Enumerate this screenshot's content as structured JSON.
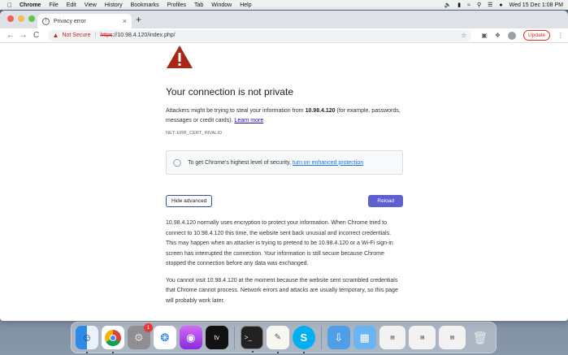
{
  "menubar": {
    "apple": "",
    "app": "Chrome",
    "items": [
      "File",
      "Edit",
      "View",
      "History",
      "Bookmarks",
      "Profiles",
      "Tab",
      "Window",
      "Help"
    ],
    "clock": "Wed 15 Dec  1:08 PM"
  },
  "tab": {
    "title": "Privacy error",
    "close": "×",
    "new_tab": "+"
  },
  "toolbar": {
    "back": "←",
    "forward": "→",
    "reload": "C",
    "not_secure": "Not Secure",
    "separator": "|",
    "url_scheme": "https",
    "url_rest": "://10.98.4.120/index.php/",
    "update_label": "Update"
  },
  "page": {
    "heading": "Your connection is not private",
    "intro_before": "Attackers might be trying to steal your information from ",
    "host": "10.98.4.120",
    "intro_after": " (for example, passwords, messages or credit cards). ",
    "learn_more": "Learn more",
    "error_code": "NET::ERR_CERT_INVALID",
    "enhanced_text": "To get Chrome's highest level of security, ",
    "enhanced_link": "turn on enhanced protection",
    "hide_advanced": "Hide advanced",
    "reload": "Reload",
    "details_1": "10.98.4.120 normally uses encryption to protect your information. When Chrome tried to connect to 10.98.4.120 this time, the website sent back unusual and incorrect credentials. This may happen when an attacker is trying to pretend to be 10.98.4.120 or a Wi-Fi sign-in screen has interrupted the connection. Your information is still secure because Chrome stopped the connection before any data was exchanged.",
    "details_2": "You cannot visit 10.98.4.120 at the moment because the website sent scrambled credentials that Chrome cannot process. Network errors and attacks are usually temporary, so this page will probably work later."
  },
  "dock": {
    "settings_badge": "1",
    "tv_label": "tv",
    "terminal_label": ">_"
  },
  "colors": {
    "danger": "#c5221f",
    "reload_button": "#5f5fd0",
    "link_blue": "#1a73e8",
    "warning_triangle": "#a52714"
  }
}
